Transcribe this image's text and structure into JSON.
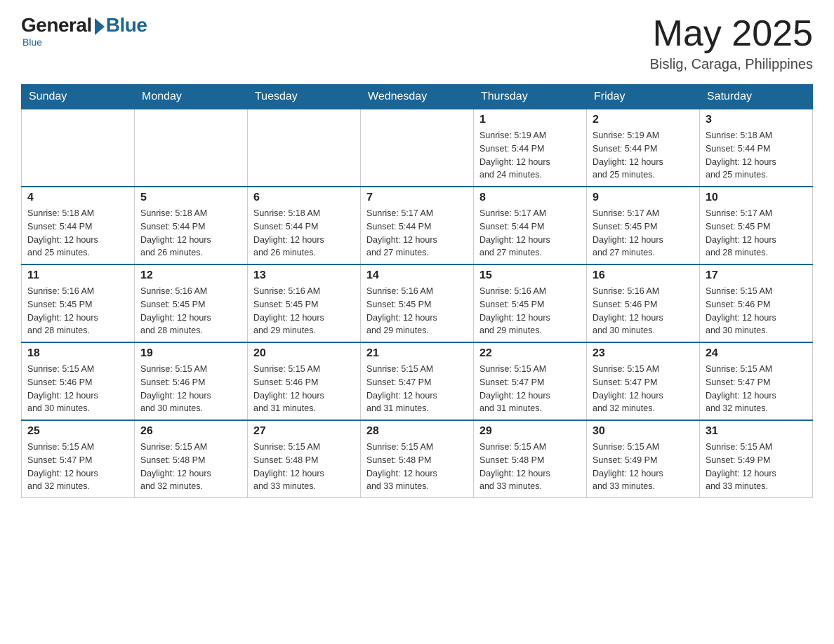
{
  "header": {
    "logo_general": "General",
    "logo_blue": "Blue",
    "month": "May 2025",
    "location": "Bislig, Caraga, Philippines"
  },
  "days_of_week": [
    "Sunday",
    "Monday",
    "Tuesday",
    "Wednesday",
    "Thursday",
    "Friday",
    "Saturday"
  ],
  "weeks": [
    [
      {
        "day": "",
        "info": ""
      },
      {
        "day": "",
        "info": ""
      },
      {
        "day": "",
        "info": ""
      },
      {
        "day": "",
        "info": ""
      },
      {
        "day": "1",
        "info": "Sunrise: 5:19 AM\nSunset: 5:44 PM\nDaylight: 12 hours\nand 24 minutes."
      },
      {
        "day": "2",
        "info": "Sunrise: 5:19 AM\nSunset: 5:44 PM\nDaylight: 12 hours\nand 25 minutes."
      },
      {
        "day": "3",
        "info": "Sunrise: 5:18 AM\nSunset: 5:44 PM\nDaylight: 12 hours\nand 25 minutes."
      }
    ],
    [
      {
        "day": "4",
        "info": "Sunrise: 5:18 AM\nSunset: 5:44 PM\nDaylight: 12 hours\nand 25 minutes."
      },
      {
        "day": "5",
        "info": "Sunrise: 5:18 AM\nSunset: 5:44 PM\nDaylight: 12 hours\nand 26 minutes."
      },
      {
        "day": "6",
        "info": "Sunrise: 5:18 AM\nSunset: 5:44 PM\nDaylight: 12 hours\nand 26 minutes."
      },
      {
        "day": "7",
        "info": "Sunrise: 5:17 AM\nSunset: 5:44 PM\nDaylight: 12 hours\nand 27 minutes."
      },
      {
        "day": "8",
        "info": "Sunrise: 5:17 AM\nSunset: 5:44 PM\nDaylight: 12 hours\nand 27 minutes."
      },
      {
        "day": "9",
        "info": "Sunrise: 5:17 AM\nSunset: 5:45 PM\nDaylight: 12 hours\nand 27 minutes."
      },
      {
        "day": "10",
        "info": "Sunrise: 5:17 AM\nSunset: 5:45 PM\nDaylight: 12 hours\nand 28 minutes."
      }
    ],
    [
      {
        "day": "11",
        "info": "Sunrise: 5:16 AM\nSunset: 5:45 PM\nDaylight: 12 hours\nand 28 minutes."
      },
      {
        "day": "12",
        "info": "Sunrise: 5:16 AM\nSunset: 5:45 PM\nDaylight: 12 hours\nand 28 minutes."
      },
      {
        "day": "13",
        "info": "Sunrise: 5:16 AM\nSunset: 5:45 PM\nDaylight: 12 hours\nand 29 minutes."
      },
      {
        "day": "14",
        "info": "Sunrise: 5:16 AM\nSunset: 5:45 PM\nDaylight: 12 hours\nand 29 minutes."
      },
      {
        "day": "15",
        "info": "Sunrise: 5:16 AM\nSunset: 5:45 PM\nDaylight: 12 hours\nand 29 minutes."
      },
      {
        "day": "16",
        "info": "Sunrise: 5:16 AM\nSunset: 5:46 PM\nDaylight: 12 hours\nand 30 minutes."
      },
      {
        "day": "17",
        "info": "Sunrise: 5:15 AM\nSunset: 5:46 PM\nDaylight: 12 hours\nand 30 minutes."
      }
    ],
    [
      {
        "day": "18",
        "info": "Sunrise: 5:15 AM\nSunset: 5:46 PM\nDaylight: 12 hours\nand 30 minutes."
      },
      {
        "day": "19",
        "info": "Sunrise: 5:15 AM\nSunset: 5:46 PM\nDaylight: 12 hours\nand 30 minutes."
      },
      {
        "day": "20",
        "info": "Sunrise: 5:15 AM\nSunset: 5:46 PM\nDaylight: 12 hours\nand 31 minutes."
      },
      {
        "day": "21",
        "info": "Sunrise: 5:15 AM\nSunset: 5:47 PM\nDaylight: 12 hours\nand 31 minutes."
      },
      {
        "day": "22",
        "info": "Sunrise: 5:15 AM\nSunset: 5:47 PM\nDaylight: 12 hours\nand 31 minutes."
      },
      {
        "day": "23",
        "info": "Sunrise: 5:15 AM\nSunset: 5:47 PM\nDaylight: 12 hours\nand 32 minutes."
      },
      {
        "day": "24",
        "info": "Sunrise: 5:15 AM\nSunset: 5:47 PM\nDaylight: 12 hours\nand 32 minutes."
      }
    ],
    [
      {
        "day": "25",
        "info": "Sunrise: 5:15 AM\nSunset: 5:47 PM\nDaylight: 12 hours\nand 32 minutes."
      },
      {
        "day": "26",
        "info": "Sunrise: 5:15 AM\nSunset: 5:48 PM\nDaylight: 12 hours\nand 32 minutes."
      },
      {
        "day": "27",
        "info": "Sunrise: 5:15 AM\nSunset: 5:48 PM\nDaylight: 12 hours\nand 33 minutes."
      },
      {
        "day": "28",
        "info": "Sunrise: 5:15 AM\nSunset: 5:48 PM\nDaylight: 12 hours\nand 33 minutes."
      },
      {
        "day": "29",
        "info": "Sunrise: 5:15 AM\nSunset: 5:48 PM\nDaylight: 12 hours\nand 33 minutes."
      },
      {
        "day": "30",
        "info": "Sunrise: 5:15 AM\nSunset: 5:49 PM\nDaylight: 12 hours\nand 33 minutes."
      },
      {
        "day": "31",
        "info": "Sunrise: 5:15 AM\nSunset: 5:49 PM\nDaylight: 12 hours\nand 33 minutes."
      }
    ]
  ]
}
